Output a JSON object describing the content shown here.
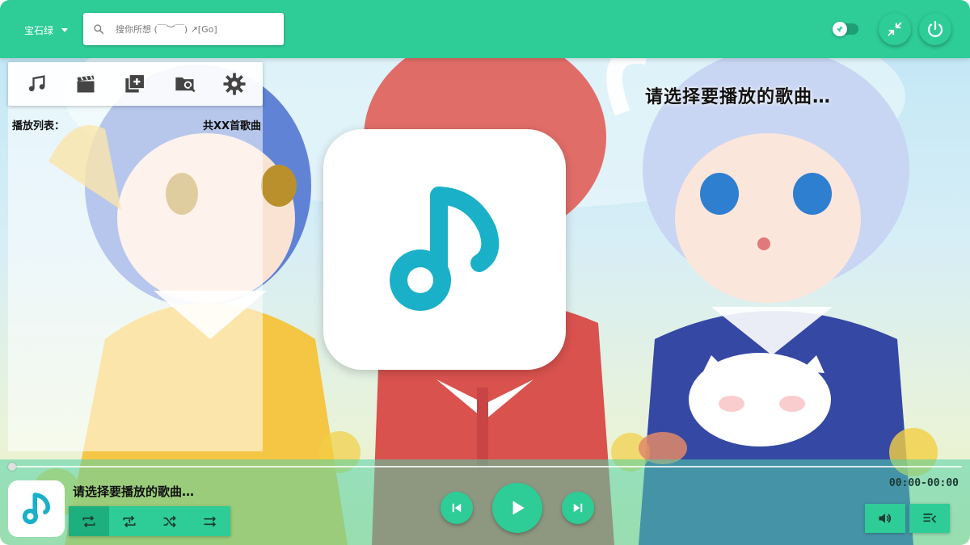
{
  "topbar": {
    "theme_label": "宝石绿",
    "search_placeholder": "搜你所想 (￣︶￣) ↗[Go]",
    "accent_color": "#2ecc96"
  },
  "menu": {
    "items": [
      {
        "name": "music-icon"
      },
      {
        "name": "video-icon"
      },
      {
        "name": "playlist-add-icon"
      },
      {
        "name": "folder-search-icon"
      },
      {
        "name": "settings-gear-icon"
      }
    ]
  },
  "playlist": {
    "label": "播放列表：",
    "count": "共XX首歌曲"
  },
  "main": {
    "song_title": "请选择要播放的歌曲…"
  },
  "player": {
    "now_playing": "请选择要播放的歌曲…",
    "time": "00:00-00:00",
    "progress": 0,
    "modes": [
      {
        "name": "repeat-all-icon",
        "active": true
      },
      {
        "name": "repeat-one-icon",
        "active": false
      },
      {
        "name": "shuffle-icon",
        "active": false
      },
      {
        "name": "sequential-icon",
        "active": false
      }
    ],
    "controls": [
      "previous-icon",
      "play-icon",
      "next-icon"
    ],
    "note_color": "#1ab0c8"
  }
}
